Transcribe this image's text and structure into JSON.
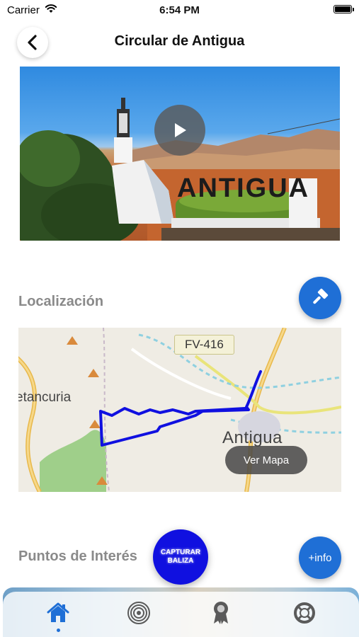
{
  "status_bar": {
    "carrier": "Carrier",
    "time": "6:54 PM"
  },
  "header": {
    "title": "Circular de Antigua",
    "back_icon": "chevron-left-icon"
  },
  "video": {
    "sign_text": "ANTIGUA",
    "play_icon": "play-icon"
  },
  "location": {
    "title": "Localización",
    "action_icon": "hammer-icon",
    "map": {
      "road_label": "FV-416",
      "town_antigua": "Antigua",
      "town_betancuria": "etancuria",
      "button_label": "Ver Mapa",
      "route_color": "#1010e0"
    }
  },
  "points_of_interest": {
    "title": "Puntos de Interés",
    "info_button": "+info"
  },
  "capture_button": {
    "line1": "CAPTURAR",
    "line2": "BALIZA"
  },
  "tabbar": {
    "items": [
      {
        "name": "home",
        "icon": "home-icon",
        "active": true
      },
      {
        "name": "beacons",
        "icon": "signal-icon",
        "active": false
      },
      {
        "name": "achievements",
        "icon": "award-icon",
        "active": false
      },
      {
        "name": "help",
        "icon": "lifebuoy-icon",
        "active": false
      }
    ]
  },
  "colors": {
    "accent": "#1f6fd6",
    "capture": "#1010e0",
    "section_title": "#8a8a8a"
  }
}
